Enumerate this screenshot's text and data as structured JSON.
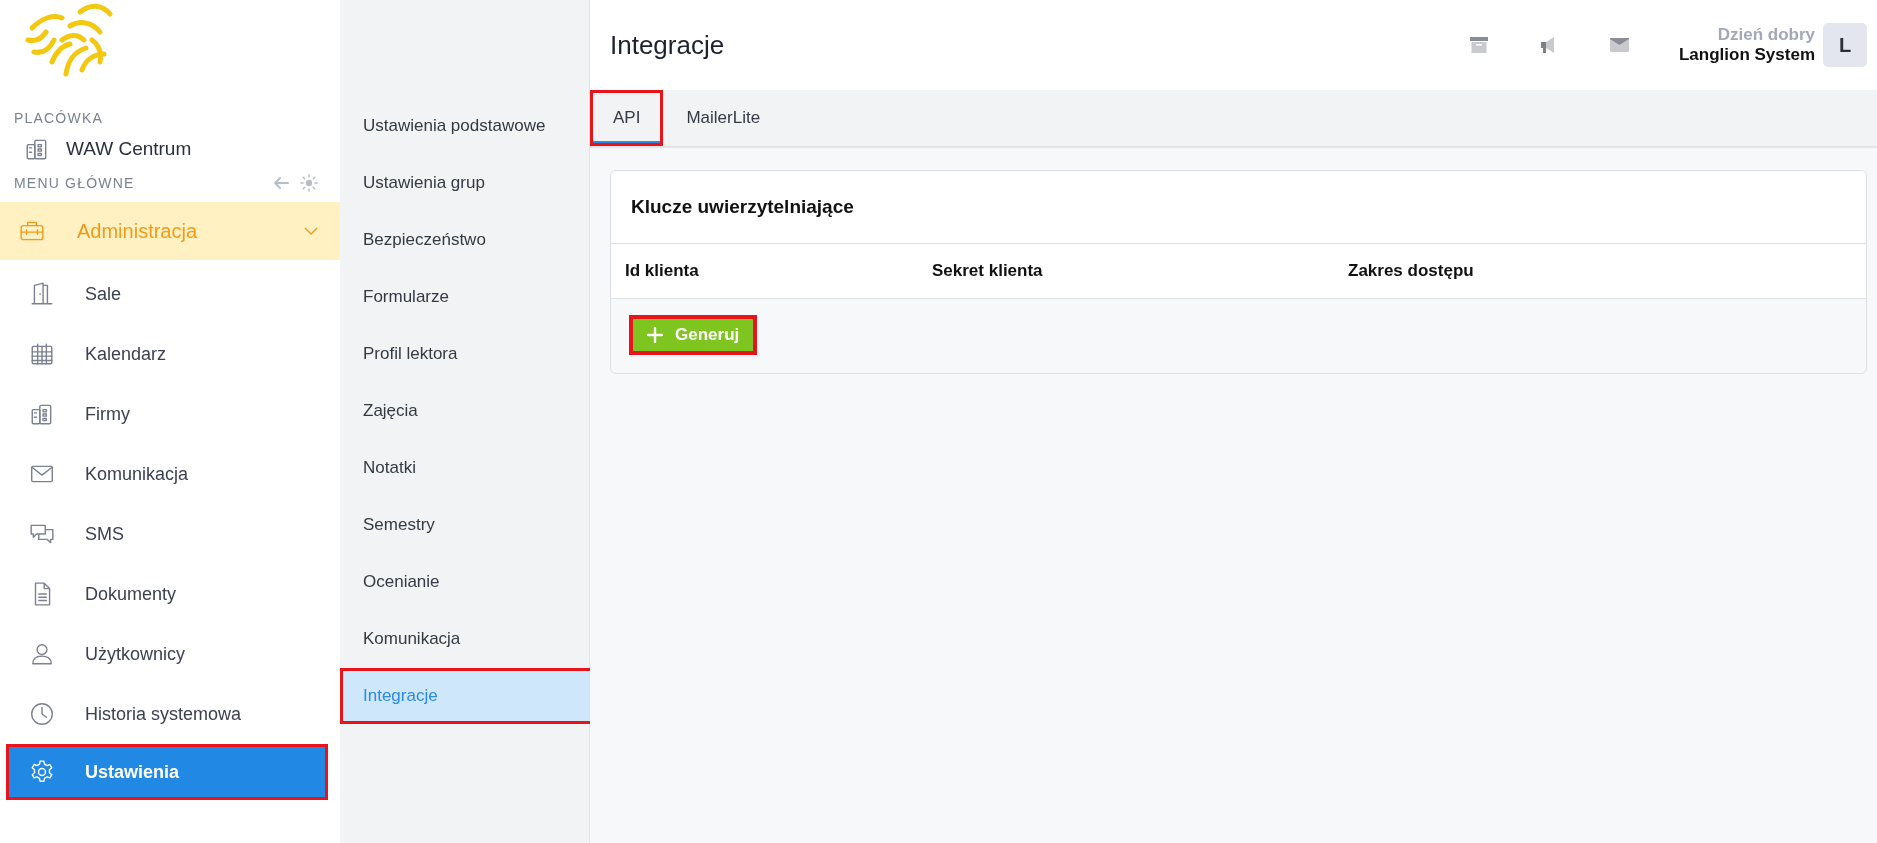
{
  "sidebar": {
    "location_label": "PLACÓWKA",
    "location": "WAW Centrum",
    "menu_label": "MENU GŁÓWNE",
    "items": [
      {
        "label": "Administracja",
        "kind": "group",
        "selected": false,
        "highlighted": false
      },
      {
        "label": "Sale",
        "kind": "link",
        "selected": false,
        "highlighted": false
      },
      {
        "label": "Kalendarz",
        "kind": "link",
        "selected": false,
        "highlighted": false
      },
      {
        "label": "Firmy",
        "kind": "link",
        "selected": false,
        "highlighted": false
      },
      {
        "label": "Komunikacja",
        "kind": "link",
        "selected": false,
        "highlighted": false
      },
      {
        "label": "SMS",
        "kind": "link",
        "selected": false,
        "highlighted": false
      },
      {
        "label": "Dokumenty",
        "kind": "link",
        "selected": false,
        "highlighted": false
      },
      {
        "label": "Użytkownicy",
        "kind": "link",
        "selected": false,
        "highlighted": false
      },
      {
        "label": "Historia systemowa",
        "kind": "link",
        "selected": false,
        "highlighted": false
      },
      {
        "label": "Ustawienia",
        "kind": "link",
        "selected": true,
        "highlighted": true
      }
    ]
  },
  "submenu": {
    "items": [
      {
        "label": "Ustawienia podstawowe",
        "selected": false,
        "highlighted": false
      },
      {
        "label": "Ustawienia grup",
        "selected": false,
        "highlighted": false
      },
      {
        "label": "Bezpieczeństwo",
        "selected": false,
        "highlighted": false
      },
      {
        "label": "Formularze",
        "selected": false,
        "highlighted": false
      },
      {
        "label": "Profil lektora",
        "selected": false,
        "highlighted": false
      },
      {
        "label": "Zajęcia",
        "selected": false,
        "highlighted": false
      },
      {
        "label": "Notatki",
        "selected": false,
        "highlighted": false
      },
      {
        "label": "Semestry",
        "selected": false,
        "highlighted": false
      },
      {
        "label": "Ocenianie",
        "selected": false,
        "highlighted": false
      },
      {
        "label": "Komunikacja",
        "selected": false,
        "highlighted": false
      },
      {
        "label": "Integracje",
        "selected": true,
        "highlighted": true
      }
    ]
  },
  "header": {
    "title": "Integracje",
    "greeting": "Dzień dobry",
    "user": "Langlion System",
    "avatar": "L"
  },
  "tabs": [
    {
      "label": "API",
      "selected": true,
      "highlighted": true
    },
    {
      "label": "MailerLite",
      "selected": false,
      "highlighted": false
    }
  ],
  "card": {
    "title": "Klucze uwierzytelniające",
    "columns": [
      "Id klienta",
      "Sekret klienta",
      "Zakres dostępu"
    ],
    "button": {
      "label": "Generuj",
      "highlighted": true
    }
  }
}
